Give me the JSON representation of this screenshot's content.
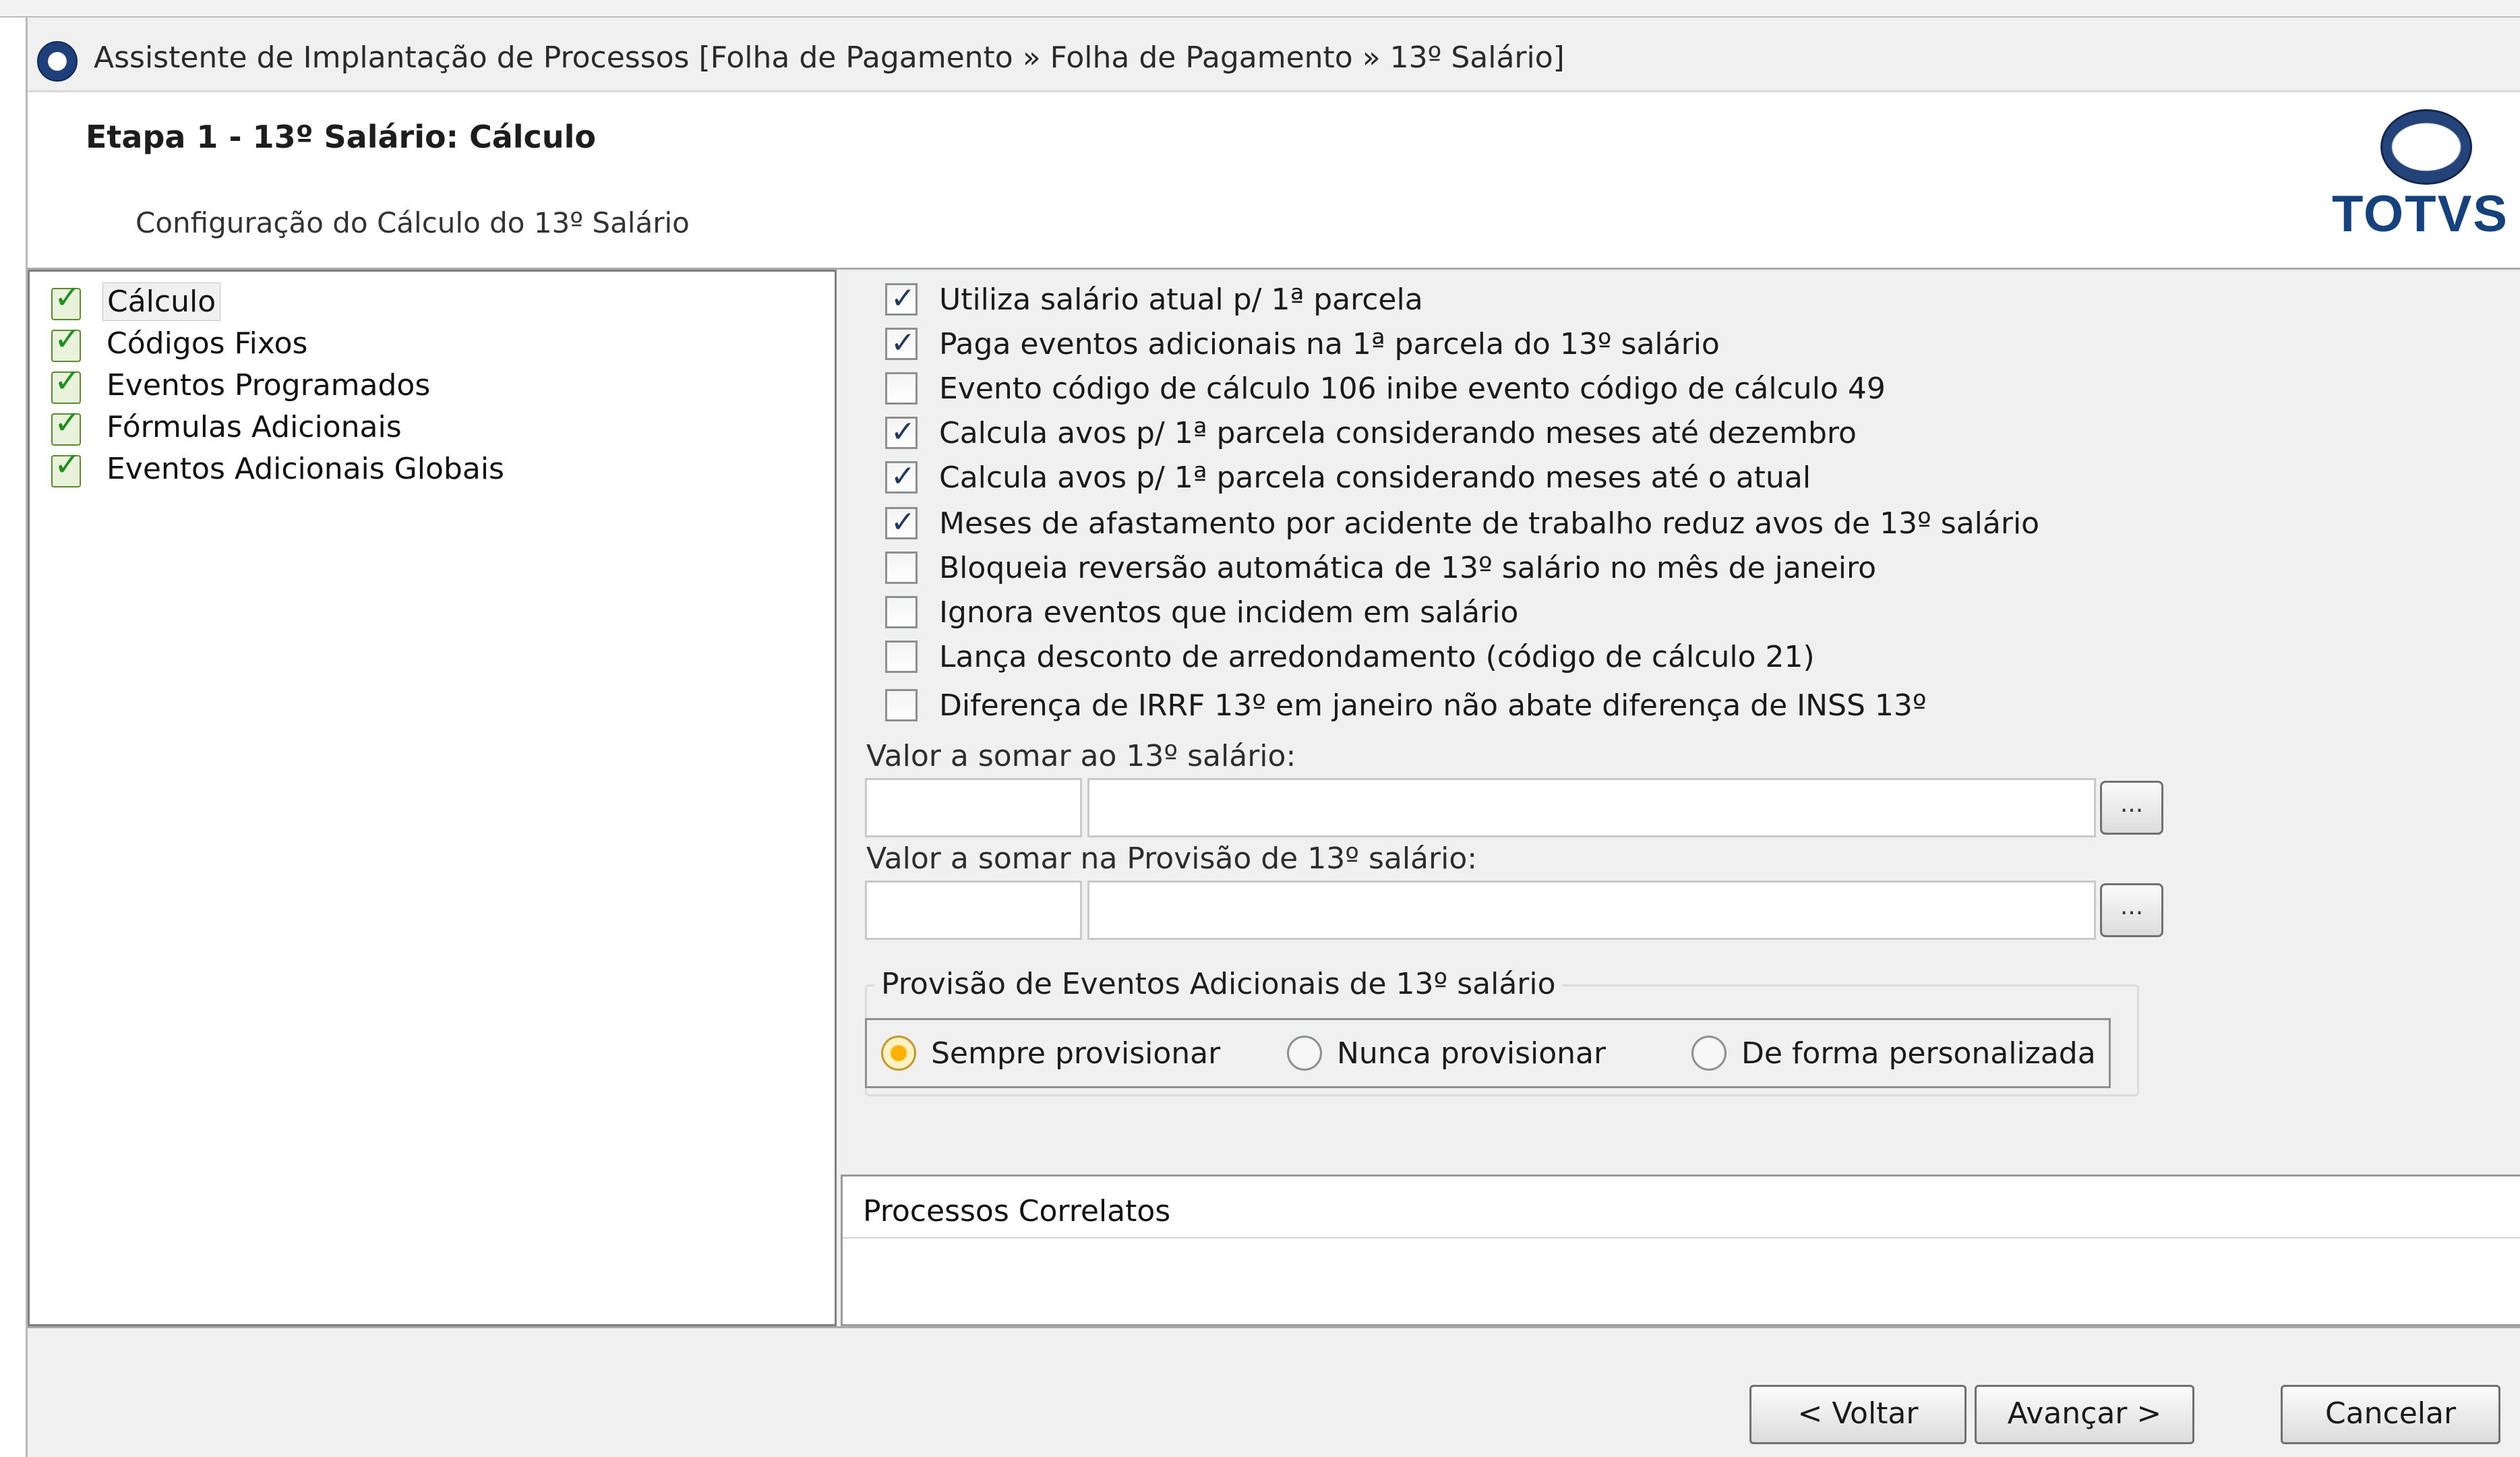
{
  "window": {
    "title": "Assistente de Implantação de Processos [Folha de Pagamento » Folha de Pagamento » 13º Salário]",
    "icon": "wizard-icon"
  },
  "header": {
    "step_title": "Etapa 1 - 13º Salário: Cálculo",
    "subtitle": "Configuração do Cálculo do 13º Salário",
    "logo_text": "TOTVS",
    "logo_color": "#15427c"
  },
  "tree": {
    "items": [
      {
        "label": "Cálculo",
        "selected": true
      },
      {
        "label": "Códigos Fixos",
        "selected": false
      },
      {
        "label": "Eventos Programados",
        "selected": false
      },
      {
        "label": "Fórmulas Adicionais",
        "selected": false
      },
      {
        "label": "Eventos Adicionais Globais",
        "selected": false
      }
    ]
  },
  "options": [
    {
      "label": "Utiliza salário atual p/ 1ª parcela",
      "checked": true
    },
    {
      "label": "Paga eventos adicionais na 1ª parcela do 13º salário",
      "checked": true
    },
    {
      "label": "Evento código de cálculo 106 inibe evento código de cálculo 49",
      "checked": false
    },
    {
      "label": "Calcula avos p/ 1ª parcela considerando meses até dezembro",
      "checked": true
    },
    {
      "label": "Calcula avos p/ 1ª parcela considerando meses até o atual",
      "checked": true
    },
    {
      "label": "Meses de afastamento por acidente de trabalho reduz avos de 13º salário",
      "checked": true
    },
    {
      "label": "Bloqueia reversão automática de 13º salário no mês de janeiro",
      "checked": false
    },
    {
      "label": "Ignora eventos que incidem em salário",
      "checked": false
    },
    {
      "label": "Lança desconto de arredondamento (código de cálculo 21)",
      "checked": false
    },
    {
      "label": "Diferença de IRRF 13º em janeiro não abate diferença de INSS 13º",
      "checked": false
    }
  ],
  "fields": {
    "valor_somar_label": "Valor a somar ao 13º salário:",
    "valor_somar_code": "",
    "valor_somar_desc": "",
    "valor_provisao_label": "Valor a somar na Provisão de 13º salário:",
    "valor_provisao_code": "",
    "valor_provisao_desc": "",
    "browse_label": "..."
  },
  "provisao": {
    "group_title": "Provisão de Eventos Adicionais de 13º salário",
    "options": [
      {
        "label": "Sempre provisionar",
        "selected": true
      },
      {
        "label": "Nunca provisionar",
        "selected": false
      },
      {
        "label": "De forma personalizada",
        "selected": false
      }
    ]
  },
  "correlatos": {
    "title": "Processos Correlatos"
  },
  "footer": {
    "back_label": "< Voltar",
    "next_label": "Avançar >",
    "cancel_label": "Cancelar"
  }
}
